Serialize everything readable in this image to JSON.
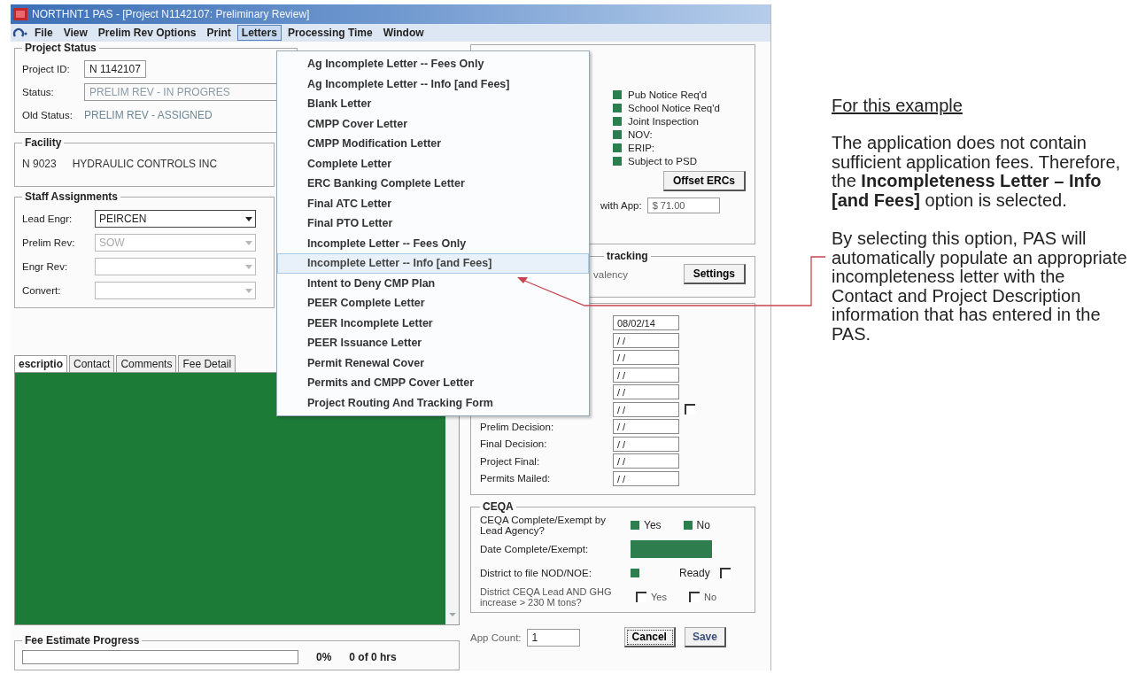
{
  "window": {
    "title": "NORTHNT1 PAS - [Project N1142107: Preliminary Review]"
  },
  "menu_bar": [
    {
      "label": "File",
      "selected": false
    },
    {
      "label": "View",
      "selected": false
    },
    {
      "label": "Prelim Rev Options",
      "selected": false
    },
    {
      "label": "Print",
      "selected": false
    },
    {
      "label": "Letters",
      "selected": true
    },
    {
      "label": "Processing Time",
      "selected": false
    },
    {
      "label": "Window",
      "selected": false
    }
  ],
  "letters_menu": [
    {
      "label": "Ag Incomplete Letter -- Fees Only",
      "selected": false
    },
    {
      "label": "Ag Incomplete Letter -- Info [and Fees]",
      "selected": false
    },
    {
      "label": "Blank Letter",
      "selected": false
    },
    {
      "label": "CMPP Cover Letter",
      "selected": false
    },
    {
      "label": "CMPP Modification Letter",
      "selected": false
    },
    {
      "label": "Complete Letter",
      "selected": false
    },
    {
      "label": "ERC Banking Complete Letter",
      "selected": false
    },
    {
      "label": "Final ATC Letter",
      "selected": false
    },
    {
      "label": "Final PTO Letter",
      "selected": false
    },
    {
      "label": "Incomplete Letter -- Fees Only",
      "selected": false
    },
    {
      "label": "Incomplete Letter -- Info [and Fees]",
      "selected": true
    },
    {
      "label": "Intent to Deny CMP Plan",
      "selected": false
    },
    {
      "label": "PEER Complete Letter",
      "selected": false
    },
    {
      "label": "PEER Incomplete Letter",
      "selected": false
    },
    {
      "label": "PEER Issuance Letter",
      "selected": false
    },
    {
      "label": "Permit Renewal Cover",
      "selected": false
    },
    {
      "label": "Permits and CMPP Cover Letter",
      "selected": false
    },
    {
      "label": "Project Routing And Tracking Form",
      "selected": false
    }
  ],
  "project_status": {
    "title": "Project Status",
    "fields": [
      {
        "label": "Project ID:",
        "value": "N 1142107",
        "kind": "box"
      },
      {
        "label": "Status:",
        "value": "PRELIM REV - IN PROGRES",
        "kind": "readonly"
      },
      {
        "label": "Old Status:",
        "value": "PRELIM REV - ASSIGNED",
        "kind": "plain"
      }
    ]
  },
  "facility": {
    "title": "Facility",
    "id": "N 9023",
    "name": "HYDRAULIC CONTROLS INC"
  },
  "staff_assignments": {
    "title": "Staff Assignments",
    "rows": [
      {
        "label": "Lead Engr:",
        "value": "PEIRCEN",
        "disabled": false
      },
      {
        "label": "Prelim Rev:",
        "value": "SOW",
        "disabled": true
      },
      {
        "label": "Engr Rev:",
        "disabled": true
      },
      {
        "label": "Convert:",
        "disabled": true
      }
    ]
  },
  "tabs": [
    {
      "label": "escriptio",
      "selected": true
    },
    {
      "label": "Contact",
      "selected": false
    },
    {
      "label": "Comments",
      "selected": false
    },
    {
      "label": "Fee Detail",
      "selected": false
    }
  ],
  "fee_progress": {
    "title": "Fee Estimate Progress",
    "level": 0,
    "percent": "0%",
    "hours": "0 of 0 hrs"
  },
  "flags_panel": {
    "flags": [
      "Pub Notice Req'd",
      "School Notice Req'd",
      "Joint Inspection",
      "NOV:",
      "ERIP:",
      "Subject to PSD"
    ],
    "offset_button": "Offset ERCs",
    "fee_label": "with App:",
    "fee_value": "$ 71.00"
  },
  "tracking": {
    "title": "tracking",
    "label": "valency",
    "button": "Settings"
  },
  "dates": {
    "rows": [
      {
        "value": "08/02/14"
      },
      {
        "value": "/ /"
      },
      {
        "value": "/ /"
      },
      {
        "value": "/ /"
      },
      {
        "value": "/ /"
      },
      {
        "value": "/ /",
        "checkbox": {
          "checked": false
        }
      },
      {
        "label": "Prelim Decision:",
        "value": "/ /"
      },
      {
        "label": "Final Decision:",
        "value": "/ /"
      },
      {
        "label": "Project Final:",
        "value": "/ /"
      },
      {
        "label": "Permits Mailed:",
        "value": "/ /"
      }
    ]
  },
  "ceqa": {
    "title": "CEQA",
    "question": "CEQA Complete/Exempt by Lead Agency?",
    "yes": "Yes",
    "no": "No",
    "date_label": "Date Complete/Exempt:",
    "nod_label": "District to file NOD/NOE:",
    "ready_label": "Ready",
    "ready_checked": false,
    "ghg_question": "District CEQA Lead AND GHG increase > 230 M tons?",
    "ghg_yes": {
      "label": "Yes",
      "checked": false
    },
    "ghg_no": {
      "label": "No",
      "checked": false
    }
  },
  "app_count": {
    "label": "App Count:",
    "value": "1"
  },
  "buttons": [
    {
      "label": "Cancel",
      "focused": true
    },
    {
      "label": "Save",
      "focused": false
    }
  ],
  "annotation": {
    "heading": "For this example",
    "paragraphs": [
      "The application does not contain sufficient application fees. Therefore, the **Incompleteness Letter – Info [and Fees]** option is selected.",
      "By selecting this option, PAS will automatically populate an appropriate incompleteness letter with the Contact and Project Description information that has entered in the PAS."
    ]
  }
}
